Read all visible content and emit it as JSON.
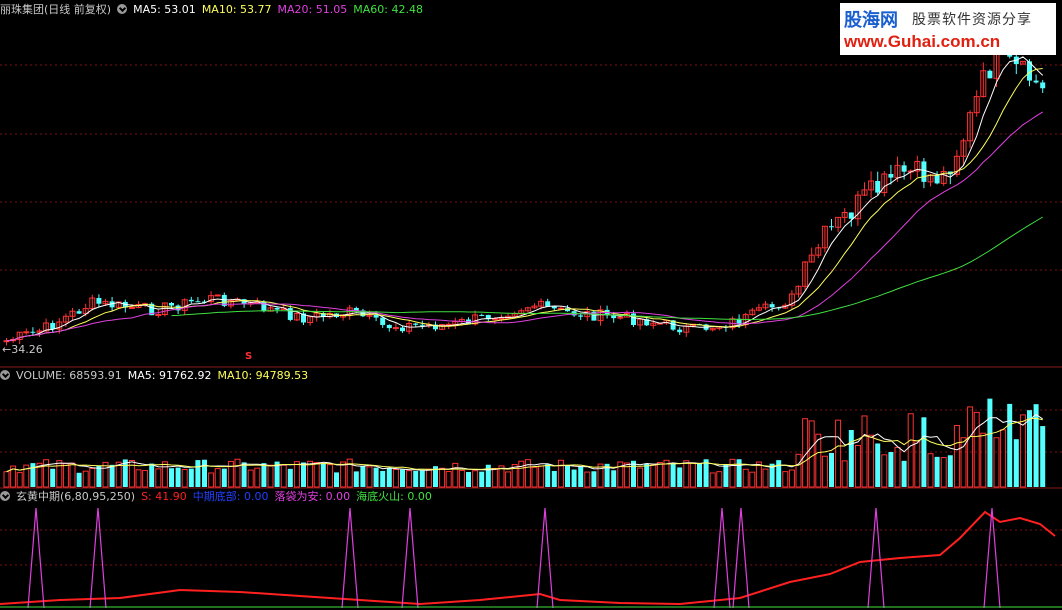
{
  "price_header": {
    "title": "丽珠集团(日线 前复权)",
    "ma5": "MA5: 53.01",
    "ma10": "MA10: 53.77",
    "ma20": "MA20: 51.05",
    "ma60": "MA60: 42.48"
  },
  "volume_header": {
    "title": "VOLUME: 68593.91",
    "ma5": "MA5: 91762.92",
    "ma10": "MA10: 94789.53"
  },
  "indicator_header": {
    "title": "玄黄中期(6,80,95,250)",
    "s": "S: 41.90",
    "zqdb": "中期底部: 0.00",
    "ldwa": "落袋为安: 0.00",
    "hdhs": "海底火山: 0.00"
  },
  "low_label": "34.26",
  "signal_mark": "S",
  "watermark": {
    "brand": "股海网",
    "tagline": "股票软件资源分享",
    "url": "www.Guhai.com.cn"
  },
  "colors": {
    "up": "#ff3232",
    "down": "#54ffff",
    "ma5": "#ffffff",
    "ma10": "#ffff5a",
    "ma20": "#e040e0",
    "ma60": "#40e040",
    "grid": "#7a1010",
    "indicator_s": "#ff2020",
    "spike": "#e040e0"
  },
  "chart_data": {
    "type": "candlestick",
    "title": "丽珠集团(日线 前复权)",
    "price_range": [
      34,
      76
    ],
    "series": [
      {
        "name": "MA5",
        "last": 53.01
      },
      {
        "name": "MA10",
        "last": 53.77
      },
      {
        "name": "MA20",
        "last": 51.05
      },
      {
        "name": "MA60",
        "last": 42.48
      }
    ],
    "volume": {
      "last": 68593.91,
      "ma5": 91762.92,
      "ma10": 94789.53
    },
    "indicator": {
      "name": "玄黄中期",
      "params": [
        6,
        80,
        95,
        250
      ],
      "S": 41.9,
      "spike_count": 9
    }
  }
}
